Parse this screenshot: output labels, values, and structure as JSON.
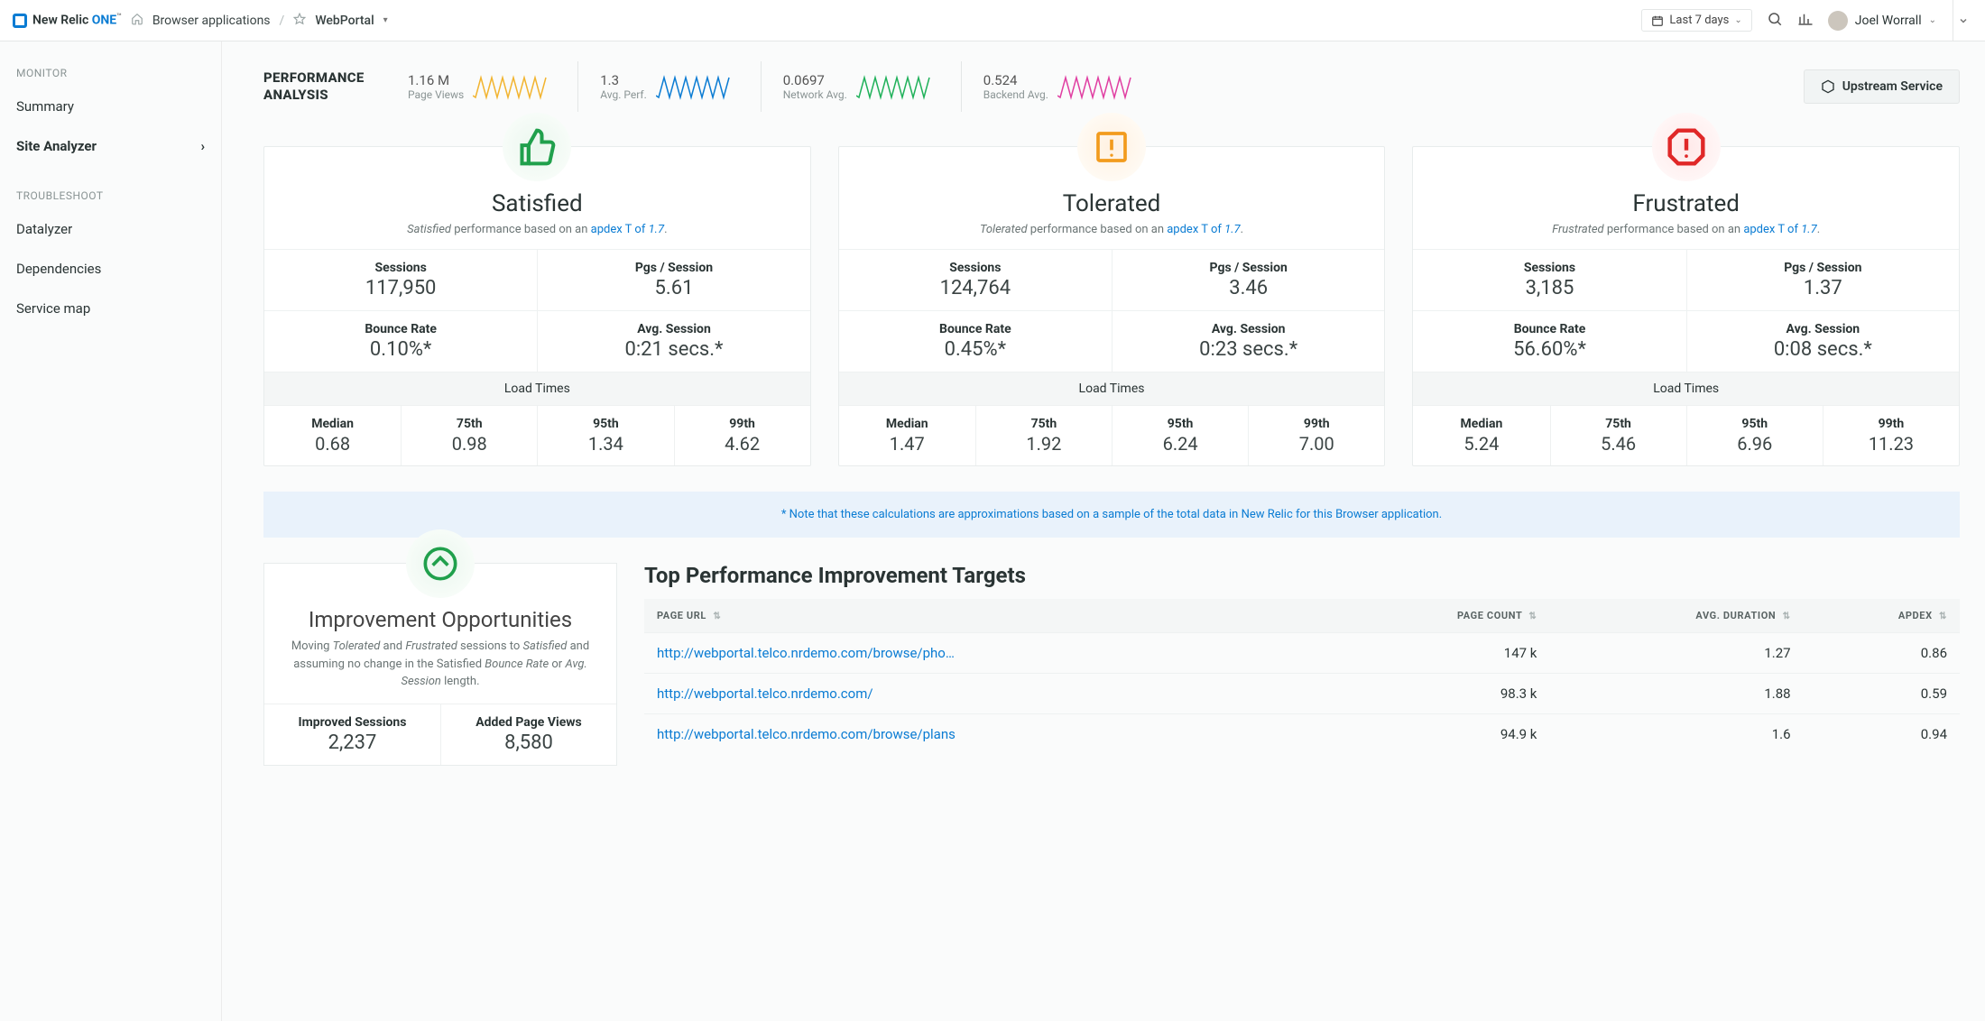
{
  "header": {
    "logo_main": "New Relic ",
    "logo_one": "ONE",
    "logo_tm": "™",
    "breadcrumb_root": "Browser applications",
    "breadcrumb_sep": "/",
    "entity_name": "WebPortal",
    "time_label": "Last 7 days",
    "user_name": "Joel Worrall"
  },
  "sidebar": {
    "groups": [
      {
        "heading": "MONITOR",
        "items": [
          {
            "label": "Summary",
            "active": false
          },
          {
            "label": "Site Analyzer",
            "active": true,
            "chevron": true
          }
        ]
      },
      {
        "heading": "TROUBLESHOOT",
        "items": [
          {
            "label": "Datalyzer"
          },
          {
            "label": "Dependencies"
          },
          {
            "label": "Service map"
          }
        ]
      }
    ]
  },
  "kpi": {
    "title": "PERFORMANCE ANALYSIS",
    "upstream_btn": "Upstream Service",
    "items": [
      {
        "value": "1.16 M",
        "label": "Page Views",
        "color": "#f2b430"
      },
      {
        "value": "1.3",
        "label": "Avg. Perf.",
        "color": "#0b7cd3"
      },
      {
        "value": "0.0697",
        "label": "Network Avg.",
        "color": "#20b15a"
      },
      {
        "value": "0.524",
        "label": "Backend Avg.",
        "color": "#e03fa2"
      }
    ]
  },
  "cards": [
    {
      "id": "satisfied",
      "title": "Satisfied",
      "tone": "green",
      "sub_prefix_em": "Satisfied",
      "sub_mid": " performance based on an ",
      "sub_link": "apdex T of ",
      "sub_link_val": "1.7",
      "sessions_k": "Sessions",
      "sessions_v": "117,950",
      "pgs_k": "Pgs / Session",
      "pgs_v": "5.61",
      "bounce_k": "Bounce Rate",
      "bounce_v": "0.10%*",
      "avg_k": "Avg. Session",
      "avg_v": "0:21 secs.*",
      "lt_head": "Load Times",
      "lt": [
        {
          "k": "Median",
          "v": "0.68"
        },
        {
          "k": "75th",
          "v": "0.98"
        },
        {
          "k": "95th",
          "v": "1.34"
        },
        {
          "k": "99th",
          "v": "4.62"
        }
      ]
    },
    {
      "id": "tolerated",
      "title": "Tolerated",
      "tone": "orange",
      "sub_prefix_em": "Tolerated",
      "sub_mid": " performance based on an ",
      "sub_link": "apdex T of ",
      "sub_link_val": "1.7",
      "sessions_k": "Sessions",
      "sessions_v": "124,764",
      "pgs_k": "Pgs / Session",
      "pgs_v": "3.46",
      "bounce_k": "Bounce Rate",
      "bounce_v": "0.45%*",
      "avg_k": "Avg. Session",
      "avg_v": "0:23 secs.*",
      "lt_head": "Load Times",
      "lt": [
        {
          "k": "Median",
          "v": "1.47"
        },
        {
          "k": "75th",
          "v": "1.92"
        },
        {
          "k": "95th",
          "v": "6.24"
        },
        {
          "k": "99th",
          "v": "7.00"
        }
      ]
    },
    {
      "id": "frustrated",
      "title": "Frustrated",
      "tone": "red",
      "sub_prefix_em": "Frustrated",
      "sub_mid": " performance based on an ",
      "sub_link": "apdex T of ",
      "sub_link_val": "1.7",
      "sessions_k": "Sessions",
      "sessions_v": "3,185",
      "pgs_k": "Pgs / Session",
      "pgs_v": "1.37",
      "bounce_k": "Bounce Rate",
      "bounce_v": "56.60%*",
      "avg_k": "Avg. Session",
      "avg_v": "0:08 secs.*",
      "lt_head": "Load Times",
      "lt": [
        {
          "k": "Median",
          "v": "5.24"
        },
        {
          "k": "75th",
          "v": "5.46"
        },
        {
          "k": "95th",
          "v": "6.96"
        },
        {
          "k": "99th",
          "v": "11.23"
        }
      ]
    }
  ],
  "note": "* Note that these calculations are approximations based on a sample of the total data in New Relic for this Browser application.",
  "improve": {
    "title": "Improvement Opportunities",
    "desc_before": "Moving ",
    "desc_em1": "Tolerated",
    "desc_mid1": " and ",
    "desc_em2": "Frustrated",
    "desc_mid2": " sessions to ",
    "desc_em3": "Satisfied",
    "desc_mid3": " and assuming no change in the Satisfied ",
    "desc_em4": "Bounce Rate",
    "desc_mid4": " or ",
    "desc_em5": "Avg. Session",
    "desc_end": " length.",
    "imp_sessions_k": "Improved Sessions",
    "imp_sessions_v": "2,237",
    "added_pv_k": "Added Page Views",
    "added_pv_v": "8,580"
  },
  "targets": {
    "title": "Top Performance Improvement Targets",
    "cols": {
      "url": "PAGE URL",
      "count": "PAGE COUNT",
      "dur": "AVG. DURATION",
      "apdex": "APDEX"
    },
    "rows": [
      {
        "url": "http://webportal.telco.nrdemo.com/browse/pho…",
        "count": "147 k",
        "dur": "1.27",
        "apdex": "0.86"
      },
      {
        "url": "http://webportal.telco.nrdemo.com/",
        "count": "98.3 k",
        "dur": "1.88",
        "apdex": "0.59"
      },
      {
        "url": "http://webportal.telco.nrdemo.com/browse/plans",
        "count": "94.9 k",
        "dur": "1.6",
        "apdex": "0.94"
      }
    ]
  },
  "chart_data": {
    "type": "sparkline",
    "series": [
      {
        "name": "Page Views",
        "color": "#f2b430"
      },
      {
        "name": "Avg. Perf.",
        "color": "#0b7cd3"
      },
      {
        "name": "Network Avg.",
        "color": "#20b15a"
      },
      {
        "name": "Backend Avg.",
        "color": "#e03fa2"
      }
    ]
  }
}
